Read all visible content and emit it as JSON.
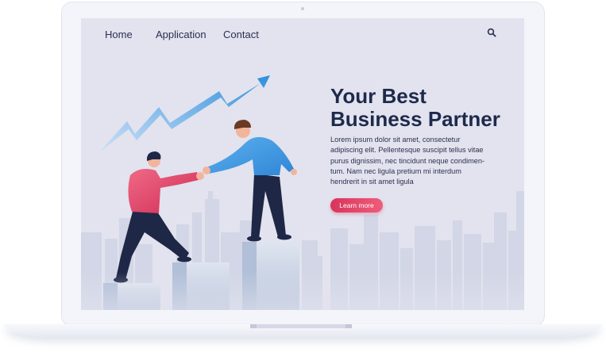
{
  "nav": {
    "items": [
      {
        "label": "Home"
      },
      {
        "label": "Application"
      },
      {
        "label": "Contact"
      }
    ],
    "search_icon": "search-icon"
  },
  "hero": {
    "title_line1": "Your Best",
    "title_line2": "Business Partner",
    "body": "Lorem ipsum dolor sit amet, consectetur adipiscing elit. Pellentesque suscipit tellus vitae purus dignissim, nec tincidunt neque condimen-tum. Nam nec ligula pretium mi interdum hendrerit in sit amet ligula",
    "cta_label": "Learn more"
  },
  "colors": {
    "accent": "#e0416a",
    "title": "#1e2a4c",
    "arrow": "#2f8fde",
    "screen_bg": "#e2e3ee"
  }
}
